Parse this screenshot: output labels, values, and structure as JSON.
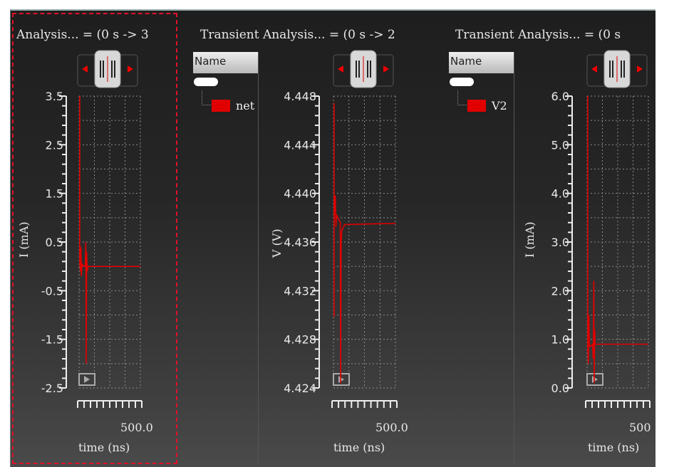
{
  "panels": [
    {
      "title": "Analysis... = (0 s ->  3",
      "ylabel": "I (mA)",
      "xlabel": "time (ns)",
      "xtick": "500.0",
      "yticks": [
        "3.5",
        "2.5",
        "1.5",
        "0.5",
        "-0.5",
        "-1.5",
        "-2.5"
      ],
      "ymin": -2.5,
      "ymax": 3.5,
      "xmax": 500,
      "trace": [
        [
          5,
          3.5
        ],
        [
          5,
          0.1
        ],
        [
          10,
          -0.1
        ],
        [
          15,
          0.4
        ],
        [
          18,
          -0.2
        ],
        [
          25,
          0.05
        ],
        [
          40,
          0
        ],
        [
          50,
          0
        ],
        [
          55,
          0.5
        ],
        [
          58,
          -2.0
        ],
        [
          62,
          0.3
        ],
        [
          66,
          -0.1
        ],
        [
          75,
          0
        ],
        [
          500,
          0
        ]
      ]
    },
    {
      "title": "Transient Analysis... = (0 s ->  2",
      "ylabel": "V (V)",
      "xlabel": "time (ns)",
      "xtick": "500.0",
      "list_header": "Name",
      "signal": "net",
      "yticks": [
        "4.448",
        "4.444",
        "4.440",
        "4.436",
        "4.432",
        "4.428",
        "4.424"
      ],
      "ymin": 4.424,
      "ymax": 4.449,
      "xmax": 500,
      "trace": [
        [
          5,
          4.4484
        ],
        [
          5,
          4.4301
        ],
        [
          5,
          4.4385
        ],
        [
          15,
          4.4405
        ],
        [
          20,
          4.4378
        ],
        [
          25,
          4.4388
        ],
        [
          55,
          4.4382
        ],
        [
          58,
          4.4244
        ],
        [
          62,
          4.4365
        ],
        [
          68,
          4.4375
        ],
        [
          90,
          4.438
        ],
        [
          500,
          4.4381
        ]
      ]
    },
    {
      "title": "Transient Analysis... = (0 s",
      "ylabel": "I (mA)",
      "xlabel": "time (ns)",
      "xtick": "500",
      "list_header": "Name",
      "signal": "V2",
      "yticks": [
        "6.0",
        "5.0",
        "4.0",
        "3.0",
        "2.0",
        "1.0",
        "0.0"
      ],
      "ymin": 0,
      "ymax": 6,
      "xmax": 500,
      "trace": [
        [
          5,
          6.0
        ],
        [
          5,
          0.8
        ],
        [
          10,
          0.5
        ],
        [
          15,
          1.5
        ],
        [
          18,
          0.9
        ],
        [
          25,
          0.85
        ],
        [
          45,
          0.9
        ],
        [
          50,
          0.6
        ],
        [
          55,
          2.2
        ],
        [
          58,
          0.1
        ],
        [
          62,
          1.2
        ],
        [
          66,
          0.9
        ],
        [
          500,
          0.9
        ]
      ]
    }
  ],
  "colors": {
    "trace": "#e00000",
    "selection": "#e0102a",
    "grid": "#8a8a8a"
  }
}
